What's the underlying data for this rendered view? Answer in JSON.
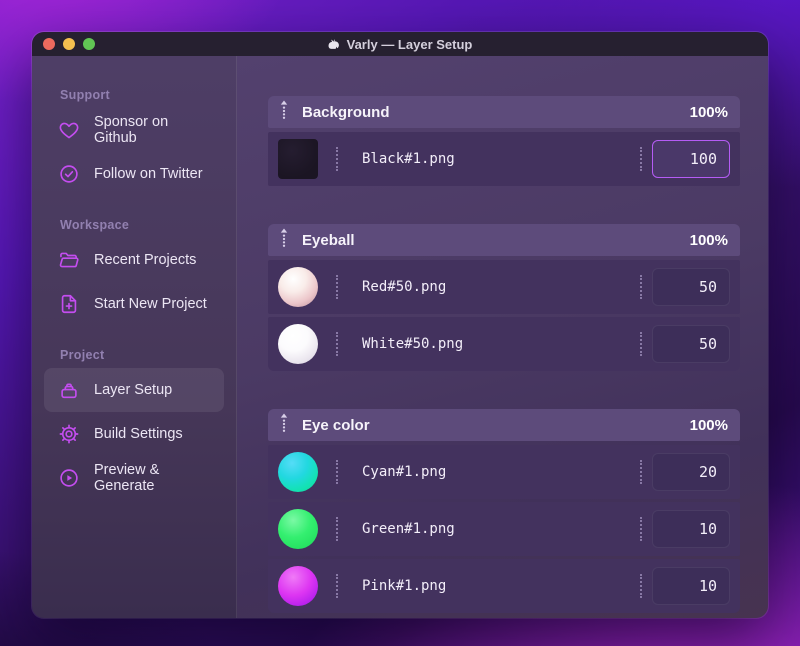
{
  "window": {
    "title": "Varly — Layer Setup",
    "app_icon": "unicorn-icon",
    "traffic_lights": [
      "close",
      "minimize",
      "zoom"
    ]
  },
  "colors": {
    "accent_icon": "#c44df0",
    "input_focus_border": "#b55cf5",
    "group_header_bg": "#5d4b7b",
    "row_bg": "#43325e",
    "thumb_black": "#1c1622",
    "thumb_red": "#ecc6ca",
    "thumb_white": "#f2eef6",
    "thumb_cyan": "#13e2b4",
    "thumb_green": "#34ef70",
    "thumb_pink": "#dd35f2"
  },
  "sidebar": {
    "sections": [
      {
        "label": "Support",
        "items": [
          {
            "icon": "heart-icon",
            "label": "Sponsor on Github"
          },
          {
            "icon": "verified-check-icon",
            "label": "Follow on Twitter"
          }
        ]
      },
      {
        "label": "Workspace",
        "items": [
          {
            "icon": "folder-icon",
            "label": "Recent Projects"
          },
          {
            "icon": "file-plus-icon",
            "label": "Start New Project"
          }
        ]
      },
      {
        "label": "Project",
        "items": [
          {
            "icon": "layers-bag-icon",
            "label": "Layer Setup",
            "active": true
          },
          {
            "icon": "gear-icon",
            "label": "Build Settings"
          },
          {
            "icon": "play-circle-icon",
            "label": "Preview & Generate"
          }
        ]
      }
    ]
  },
  "main": {
    "groups": [
      {
        "name": "Background",
        "weight": "100%",
        "rows": [
          {
            "thumb": "black-square",
            "filename": "Black#1.png",
            "value": "100",
            "focused": true
          }
        ]
      },
      {
        "name": "Eyeball",
        "weight": "100%",
        "rows": [
          {
            "thumb": "red-sphere",
            "filename": "Red#50.png",
            "value": "50"
          },
          {
            "thumb": "white-sphere",
            "filename": "White#50.png",
            "value": "50"
          }
        ]
      },
      {
        "name": "Eye color",
        "weight": "100%",
        "rows": [
          {
            "thumb": "cyan-circle",
            "filename": "Cyan#1.png",
            "value": "20"
          },
          {
            "thumb": "green-circle",
            "filename": "Green#1.png",
            "value": "10"
          },
          {
            "thumb": "pink-circle",
            "filename": "Pink#1.png",
            "value": "10"
          }
        ]
      }
    ]
  }
}
